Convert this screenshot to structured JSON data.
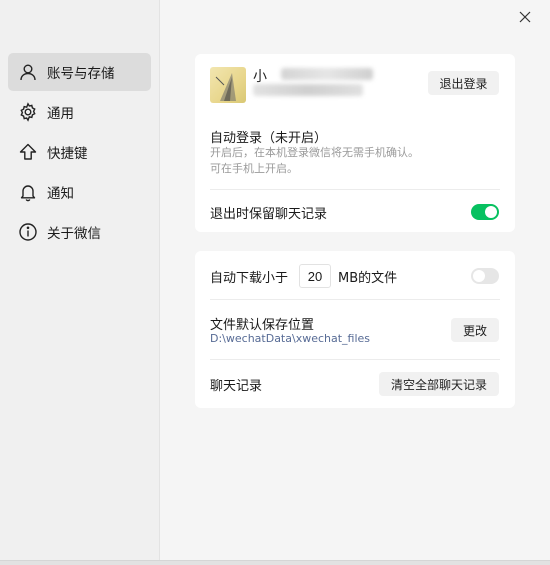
{
  "window": {
    "close_icon": "close-icon"
  },
  "sidebar": {
    "items": [
      {
        "label": "账号与存储",
        "icon": "user-icon",
        "active": true
      },
      {
        "label": "通用",
        "icon": "gear-icon",
        "active": false
      },
      {
        "label": "快捷键",
        "icon": "up-arrow-icon",
        "active": false
      },
      {
        "label": "通知",
        "icon": "bell-icon",
        "active": false
      },
      {
        "label": "关于微信",
        "icon": "info-icon",
        "active": false
      }
    ]
  },
  "account": {
    "nickname_visible": "小",
    "logout_button": "退出登录",
    "auto_login_title": "自动登录（未开启）",
    "auto_login_desc_line1": "开启后，在本机登录微信将无需手机确认。",
    "auto_login_desc_line2": "可在手机上开启。",
    "keep_history_label": "退出时保留聊天记录",
    "keep_history_enabled": true
  },
  "storage": {
    "auto_download_prefix": "自动下载小于",
    "auto_download_size": "20",
    "auto_download_suffix": "MB的文件",
    "auto_download_enabled": false,
    "save_location_title": "文件默认保存位置",
    "save_location_path": "D:\\wechatData\\xwechat_files",
    "change_button": "更改",
    "chat_history_label": "聊天记录",
    "clear_history_button": "清空全部聊天记录"
  },
  "colors": {
    "accent_green": "#07c160",
    "link_blue": "#576b95"
  }
}
